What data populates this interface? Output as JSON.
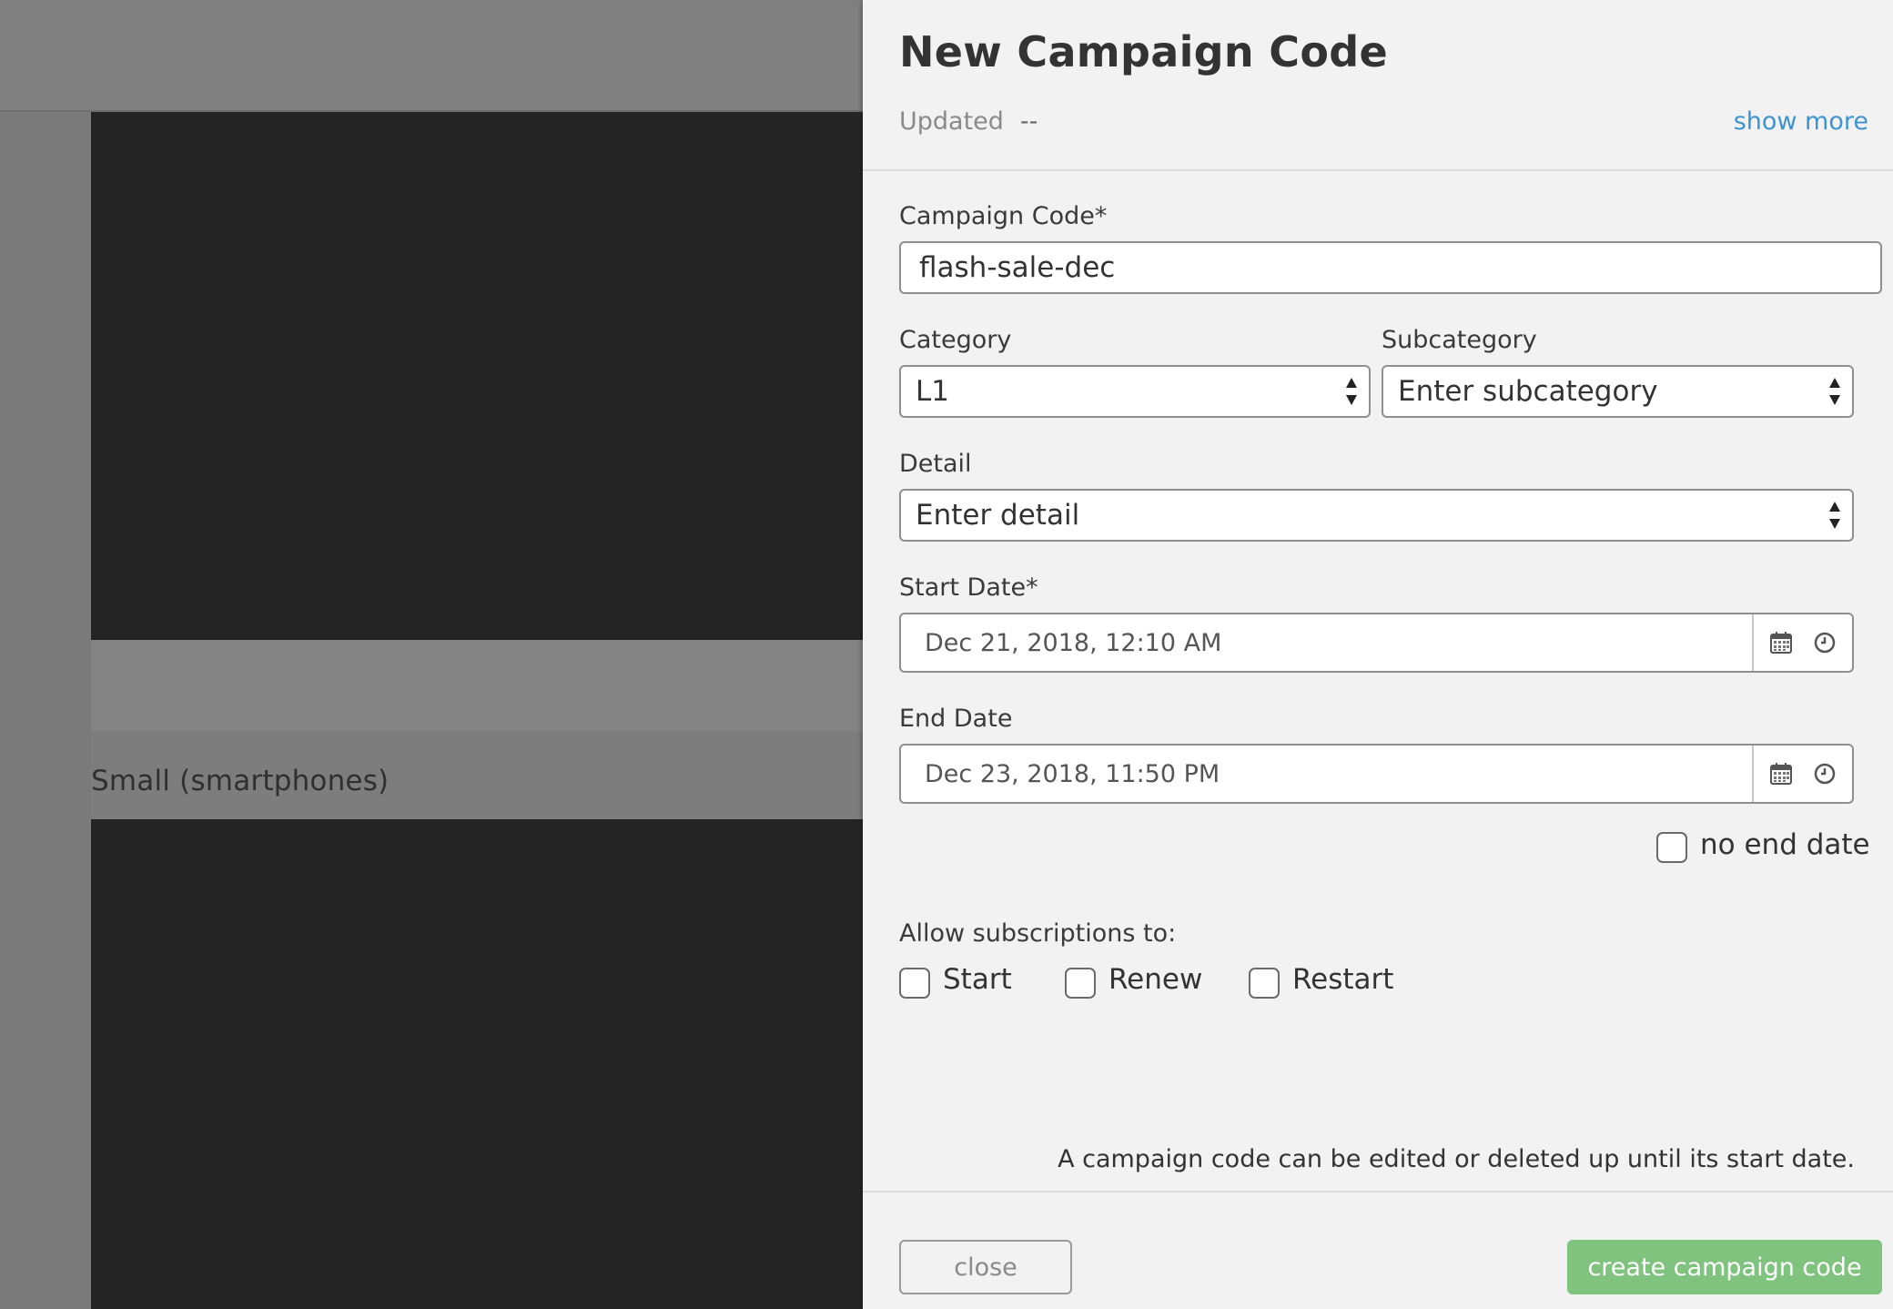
{
  "background": {
    "preview_label": "Small (smartphones)"
  },
  "drawer": {
    "title": "New Campaign Code",
    "updated_label": "Updated",
    "updated_value": "--",
    "show_more": "show more",
    "fields": {
      "campaign_code": {
        "label": "Campaign Code*",
        "value": "flash-sale-dec"
      },
      "category": {
        "label": "Category",
        "value": "L1"
      },
      "subcategory": {
        "label": "Subcategory",
        "value": "Enter subcategory"
      },
      "detail": {
        "label": "Detail",
        "value": "Enter detail"
      },
      "start_date": {
        "label": "Start Date*",
        "value": "Dec 21, 2018, 12:10 AM"
      },
      "end_date": {
        "label": "End Date",
        "value": "Dec 23, 2018, 11:50 PM"
      },
      "no_end_date": {
        "label": "no end date",
        "checked": false
      }
    },
    "subscriptions": {
      "label": "Allow subscriptions to:",
      "options": [
        {
          "label": "Start",
          "checked": false
        },
        {
          "label": "Renew",
          "checked": false
        },
        {
          "label": "Restart",
          "checked": false
        }
      ]
    },
    "note": "A campaign code can be edited or deleted up until its start date.",
    "buttons": {
      "close": "close",
      "create": "create campaign code"
    }
  },
  "colors": {
    "accent_link": "#3f93cf",
    "primary_button": "#7fc37f",
    "drawer_bg": "#f2f2f2",
    "overlay_dark": "#242424"
  },
  "icons": [
    "calendar-icon",
    "clock-icon",
    "select-arrows-icon"
  ]
}
